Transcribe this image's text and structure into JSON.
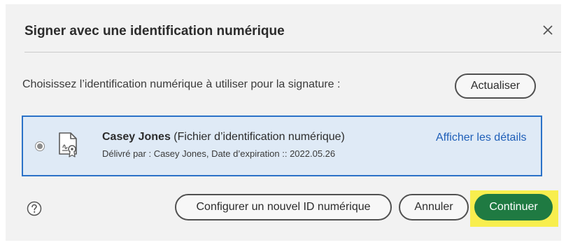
{
  "dialog": {
    "title": "Signer avec une identification numérique",
    "close_icon": "close-icon"
  },
  "prompt": "Choisissez l’identification numérique à utiliser pour la signature :",
  "refresh_label": "Actualiser",
  "identity": {
    "selected": true,
    "name": "Casey Jones",
    "type": " (Fichier d’identification numérique)",
    "issued_info": "Délivré par : Casey Jones, Date d’expiration :: 2022.05.26",
    "details_link": "Afficher les détails",
    "icon": "certificate-icon"
  },
  "footer": {
    "help_icon": "help-icon",
    "configure_label": "Configurer un nouvel ID numérique",
    "cancel_label": "Annuler",
    "continue_label": "Continuer"
  },
  "colors": {
    "selection_border": "#2b72c8",
    "selection_fill": "#dfeaf6",
    "link": "#1f5fb8",
    "primary_button": "#1f7a42",
    "highlight": "#f8ee4e"
  }
}
